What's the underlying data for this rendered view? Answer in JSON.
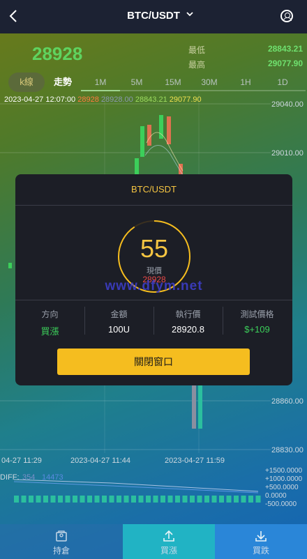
{
  "header": {
    "title": "BTC/USDT",
    "back_icon": "chevron-left-icon",
    "user_icon": "user-circle-icon"
  },
  "price": {
    "current": "28928",
    "low_label": "最低",
    "low_value": "28843.21",
    "high_label": "最高",
    "high_value": "29077.90"
  },
  "tabs": [
    {
      "label": "k線"
    },
    {
      "label": "走勢"
    },
    {
      "label": "1M"
    },
    {
      "label": "5M"
    },
    {
      "label": "15M"
    },
    {
      "label": "30M"
    },
    {
      "label": "1H"
    },
    {
      "label": "1D"
    }
  ],
  "ohlc": {
    "time": "2023-04-27 12:07:00",
    "open": "28928",
    "close": "28928.00",
    "low": "28843.21",
    "high": "29077.90"
  },
  "chart_data": {
    "type": "candlestick",
    "y_ticks": [
      "29040.00",
      "29010.00",
      "28860.00",
      "28830.00"
    ],
    "x_ticks": [
      "04-27 11:29",
      "2023-04-27 11:44",
      "2023-04-27 11:59"
    ],
    "macd_ticks": [
      "+1500.0000",
      "+1000.0000",
      "+500.0000",
      "0.0000",
      "-500.0000"
    ],
    "diff_label": "DIFF:",
    "diff_values": [
      "354",
      "14473"
    ]
  },
  "modal": {
    "title": "BTC/USDT",
    "countdown": "55",
    "countdown_label": "現價",
    "current_price": "28928",
    "watermark": "www.dfym.net",
    "columns": [
      {
        "header": "方向",
        "value": "買漲"
      },
      {
        "header": "金額",
        "value": "100U"
      },
      {
        "header": "執行價",
        "value": "28920.8"
      },
      {
        "header": "測試價格",
        "value": "$+109"
      }
    ],
    "close_label": "關閉窗口"
  },
  "bottom_nav": [
    {
      "label": "持倉",
      "icon": "portfolio-icon"
    },
    {
      "label": "買漲",
      "icon": "upload-icon"
    },
    {
      "label": "買跌",
      "icon": "download-icon"
    }
  ],
  "colors": {
    "accent": "#f5bd1f",
    "rise": "#3ccf5a",
    "fall": "#e84848",
    "modal_bg": "#1c1e26"
  }
}
